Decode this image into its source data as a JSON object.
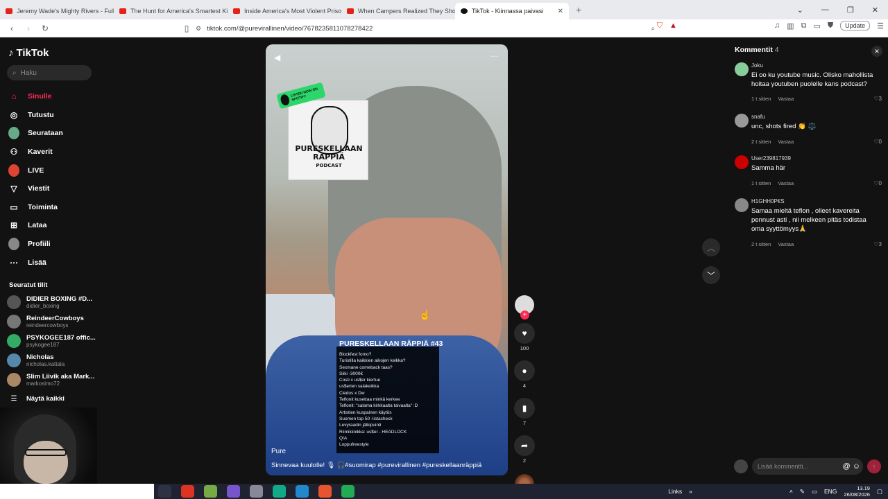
{
  "browser": {
    "tabs": [
      {
        "label": "Jeremy Wade's Mighty Rivers - Full E",
        "active": false
      },
      {
        "label": "The Hunt for America's Smartest Kille",
        "active": false
      },
      {
        "label": "Inside America's Most Violent Prison",
        "active": false
      },
      {
        "label": "When Campers Realized They Should",
        "active": false
      },
      {
        "label": "TikTok - Kiinnassa paivasi",
        "active": true
      }
    ],
    "new_tab": "+",
    "url": "tiktok.com/@purevirallinen/video/7678235811078278422",
    "update_label": "Update"
  },
  "sidebar": {
    "logo": "TikTok",
    "search_placeholder": "Haku",
    "items": [
      {
        "label": "Sinulle",
        "icon": "home-icon",
        "active": true
      },
      {
        "label": "Tutustu",
        "icon": "compass-icon",
        "active": false
      },
      {
        "label": "Seurataan",
        "icon": "following-icon",
        "active": false
      },
      {
        "label": "Kaverit",
        "icon": "friends-icon",
        "active": false
      },
      {
        "label": "LIVE",
        "icon": "live-icon",
        "active": false
      },
      {
        "label": "Viestit",
        "icon": "messages-icon",
        "active": false
      },
      {
        "label": "Toiminta",
        "icon": "activity-icon",
        "active": false
      },
      {
        "label": "Lataa",
        "icon": "upload-icon",
        "active": false
      },
      {
        "label": "Profiili",
        "icon": "profile-icon",
        "active": false
      },
      {
        "label": "Lisää",
        "icon": "more-icon",
        "active": false
      }
    ],
    "following_title": "Seuratut tilit",
    "accounts": [
      {
        "name": "DIDIER BOXING #D...",
        "handle": "didier_boxing",
        "color": "#555"
      },
      {
        "name": "ReindeerCowboys",
        "handle": "reindeercowboys",
        "color": "#777"
      },
      {
        "name": "PSYKOGEE187 offic...",
        "handle": "psykogee187",
        "color": "#3a6"
      },
      {
        "name": "Nicholas",
        "handle": "nicholas.kattala",
        "color": "#58a"
      },
      {
        "name": "Slim Liivik aka Mark...",
        "handle": "markosimo72",
        "color": "#a86"
      }
    ],
    "show_all": "Näytä kaikki"
  },
  "video": {
    "sticker_lines": [
      "PURESKELLAAN",
      "RÄPPIÄ",
      "PODCAST"
    ],
    "spotify_label": "LISTEN NOW ON SPOTIFY",
    "overlay_title": "PURESKELLAAN RÄPPIÄ #43",
    "topics": [
      "Blockfest fomo?",
      "Turistilla kaikkien aikojen keikka?",
      "Sexmane comeback taas?",
      "Siiki -3000€",
      "Costi x us$er kiertue",
      "us$erien salakeikka",
      "Cledos x Dw",
      "Teflonit kusettaa minkä kerkee",
      "Teflonit: \"salama kirkkaalta taivaalta\" :D",
      "Artistien kuspainen käytös",
      "Suomen top 50 -listacheck",
      "Levyraadin jälkipuinti",
      "Riimikiinikka: us$er - HEADLOCK",
      "Q/A",
      "Loppufreestyle"
    ],
    "author": "Pure",
    "caption": "Sinnevaa kuulolle! 🎙 🎧#suomirap #purevirallinen #pureskellaanräppiä",
    "likes": "100",
    "comments": "4",
    "saves": "7",
    "shares": "2"
  },
  "comments_panel": {
    "title": "Kommentit",
    "count": "4",
    "items": [
      {
        "user": "Joku",
        "text": "Ei oo ku youtube music. Olisko mahollista hoitaa youtuben puolelle kans podcast?",
        "time": "1 t sitten",
        "reply": "Vastaa",
        "likes": "3",
        "color": "#8c9"
      },
      {
        "user": "snafu",
        "text": "unc, shots fired 👏 ⚖️",
        "time": "2 t sitten",
        "reply": "Vastaa",
        "likes": "0",
        "color": "#999"
      },
      {
        "user": "User239817939",
        "text": "Samma här",
        "time": "1 t sitten",
        "reply": "Vastaa",
        "likes": "0",
        "color": "#c00"
      },
      {
        "user": "H1GHH0P€S",
        "text": "Samaa mieltä teflon , olleet kavereita pennust asti , nii melkeen pitäs todistaa oma syyttömyys🙏",
        "time": "2 t sitten",
        "reply": "Vastaa",
        "likes": "3",
        "color": "#888"
      }
    ],
    "input_placeholder": "Lisää kommentti..."
  },
  "taskbar": {
    "links_label": "Links",
    "lang": "ENG",
    "time": "13.19",
    "date": "26/08/2026"
  }
}
